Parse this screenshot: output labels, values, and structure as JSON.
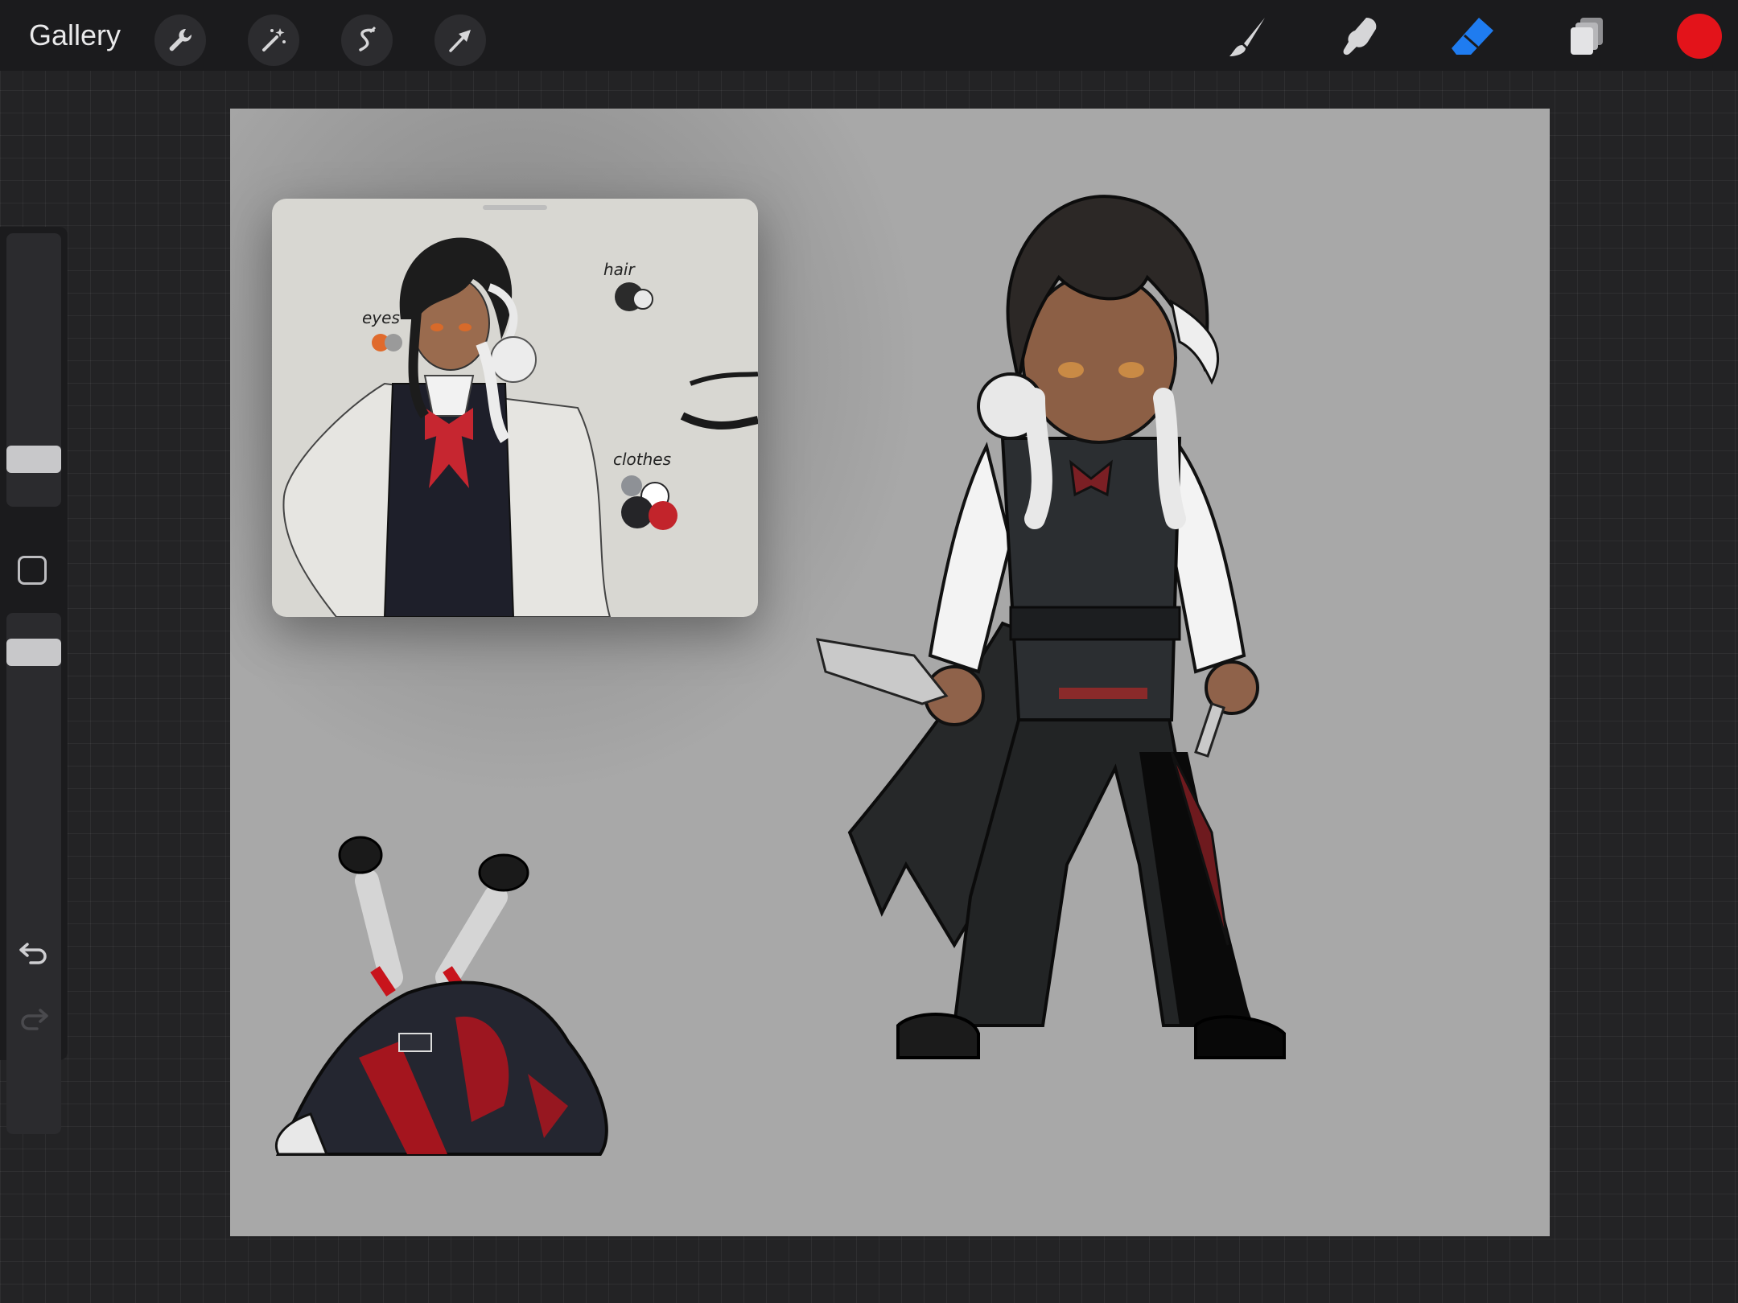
{
  "toolbar": {
    "gallery_label": "Gallery",
    "left_tools": [
      "wrench-icon",
      "magic-wand-icon",
      "selection-icon",
      "transform-arrow-icon"
    ],
    "right_tools": [
      "brush-icon",
      "smudge-icon",
      "eraser-icon",
      "layers-icon"
    ],
    "active_tool": "eraser-icon",
    "active_color": "#e3131a",
    "accent_color": "#1f7cf0"
  },
  "sidebar": {
    "brush_size_level": 0.2,
    "opacity_level": 0.1,
    "controls": [
      "modifier-square",
      "undo-icon",
      "redo-icon"
    ]
  },
  "reference_window": {
    "labels": {
      "eyes": "eyes",
      "hair": "hair",
      "clothes": "clothes"
    },
    "swatches": {
      "eyes": [
        "#e06a2c",
        "#9a9a9a"
      ],
      "hair": [
        "#2b2b2b",
        "#e8e8e8"
      ],
      "clothes": [
        "#8e9196",
        "#ffffff",
        "#252528",
        "#c2242b"
      ]
    }
  },
  "canvas": {
    "background": "#a8a8a8"
  }
}
